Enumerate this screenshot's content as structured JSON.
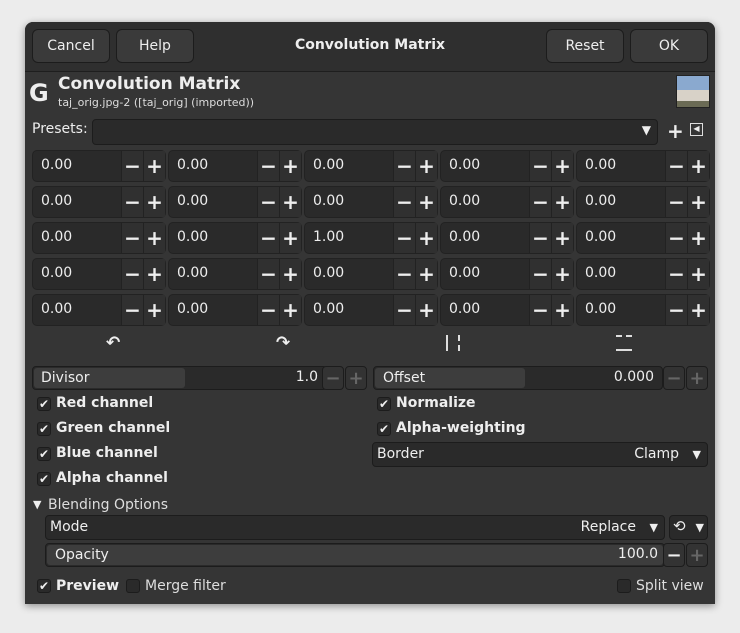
{
  "header": {
    "cancel": "Cancel",
    "help": "Help",
    "title": "Convolution Matrix",
    "reset": "Reset",
    "ok": "OK"
  },
  "plugin": {
    "title": "Convolution Matrix",
    "subtitle": "taj_orig.jpg-2 ([taj_orig] (imported))",
    "logo_icon": "gimp-logo-icon",
    "thumbnail_icon": "image-thumbnail"
  },
  "presets": {
    "label": "Presets:",
    "value": ""
  },
  "matrix": [
    [
      "0.00",
      "0.00",
      "0.00",
      "0.00",
      "0.00"
    ],
    [
      "0.00",
      "0.00",
      "0.00",
      "0.00",
      "0.00"
    ],
    [
      "0.00",
      "0.00",
      "1.00",
      "0.00",
      "0.00"
    ],
    [
      "0.00",
      "0.00",
      "0.00",
      "0.00",
      "0.00"
    ],
    [
      "0.00",
      "0.00",
      "0.00",
      "0.00",
      "0.00"
    ]
  ],
  "transforms": [
    "rotate-left-icon",
    "rotate-right-icon",
    "flip-horizontal-icon",
    "flip-vertical-icon"
  ],
  "divisor": {
    "label": "Divisor",
    "value": "1.0"
  },
  "offset": {
    "label": "Offset",
    "value": "0.000"
  },
  "channels": [
    {
      "label": "Red channel",
      "checked": true
    },
    {
      "label": "Green channel",
      "checked": true
    },
    {
      "label": "Blue channel",
      "checked": true
    },
    {
      "label": "Alpha channel",
      "checked": true
    }
  ],
  "normalize": {
    "label": "Normalize",
    "checked": true
  },
  "alpha_weighting": {
    "label": "Alpha-weighting",
    "checked": true
  },
  "border": {
    "label": "Border",
    "value": "Clamp"
  },
  "blending": {
    "label": "Blending Options",
    "mode_label": "Mode",
    "mode_value": "Replace",
    "opacity_label": "Opacity",
    "opacity_value": "100.0"
  },
  "footer": {
    "preview": "Preview",
    "merge": "Merge filter",
    "split": "Split view"
  },
  "colors": {
    "background": "#353535",
    "headerbar": "#2f2f2f",
    "entry": "#2a2a2a"
  }
}
